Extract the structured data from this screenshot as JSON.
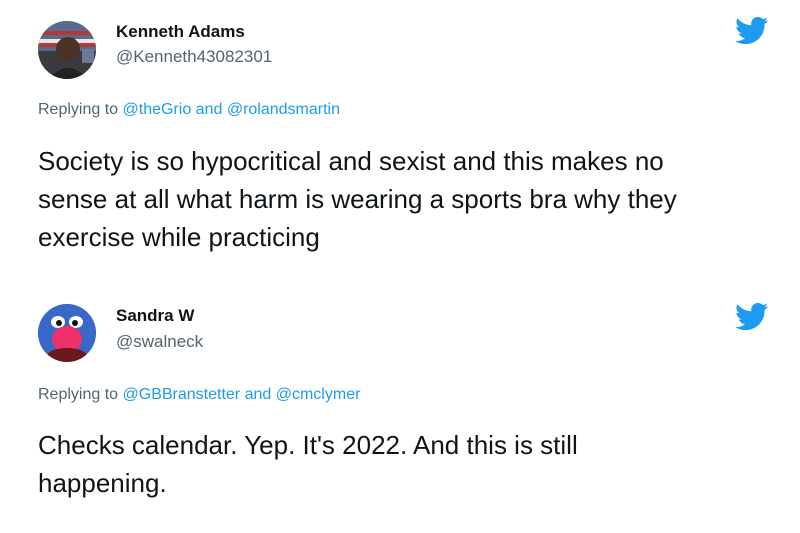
{
  "tweets": [
    {
      "display_name": "Kenneth Adams",
      "handle": "@Kenneth43082301",
      "replying_prefix": "Replying to",
      "mention_1": "@theGrio",
      "conjunction": "and",
      "mention_2": "@rolandsmartin",
      "text_lines": [
        "Society is so hypocritical and sexist and this makes no",
        "sense at all what harm is wearing a sports bra why they",
        "exercise while practicing"
      ],
      "icon": "twitter-bird-icon"
    },
    {
      "display_name": "Sandra W",
      "handle": "@swalneck",
      "replying_prefix": "Replying to",
      "mention_1": "@GBBranstetter",
      "conjunction": "and",
      "mention_2": "@cmclymer",
      "text_lines": [
        "Checks calendar. Yep. It's 2022. And this is still",
        "happening."
      ],
      "icon": "twitter-bird-icon"
    }
  ],
  "colors": {
    "accent": "#1d9bf0",
    "secondary_text": "#536471",
    "primary_text": "#0f1419"
  }
}
